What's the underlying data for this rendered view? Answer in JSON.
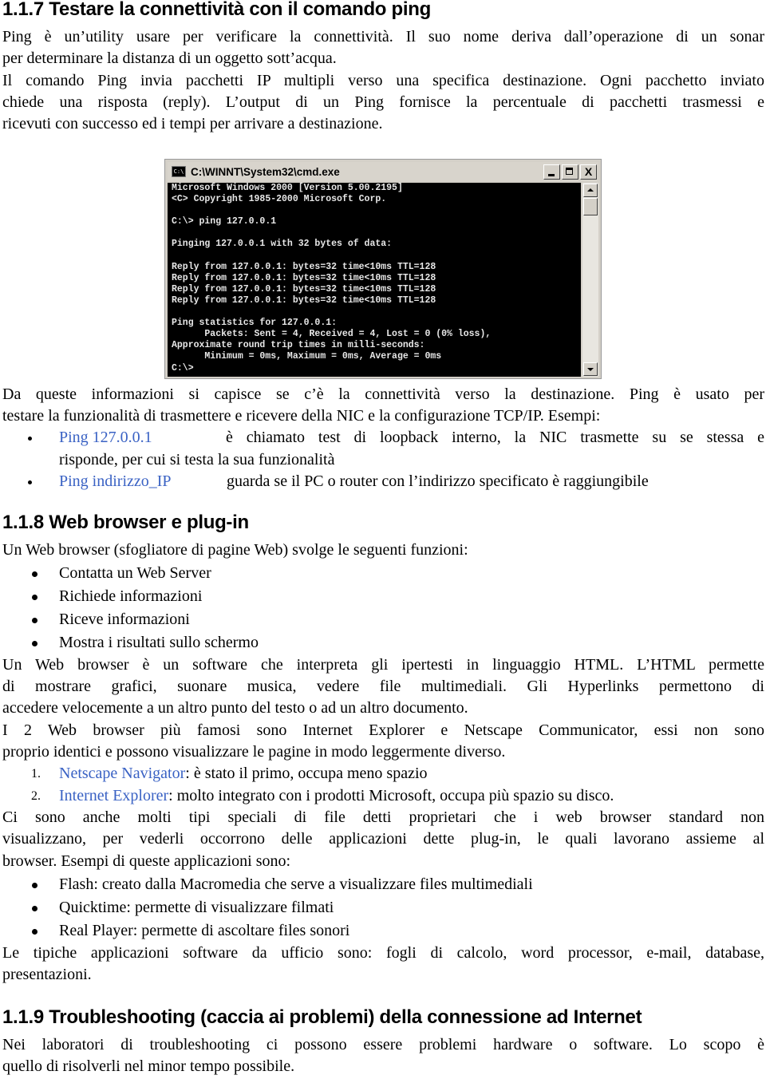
{
  "section_117": {
    "heading": "1.1.7 Testare la connettività con il comando ping",
    "para1_line1": "Ping è un’utility usare per verificare la connettività. Il suo nome deriva dall’operazione di un sonar",
    "para1_line2": "per determinare la distanza di un oggetto sott’acqua.",
    "para2_line1": "Il comando Ping invia pacchetti IP multipli verso una specifica destinazione. Ogni pacchetto inviato",
    "para2_line2": "chiede una risposta (reply). L’output di un Ping fornisce la percentuale di pacchetti trasmessi e",
    "para2_line3": "ricevuti con successo ed i tempi per arrivare a destinazione.",
    "cmd_window": {
      "title": "C:\\WINNT\\System32\\cmd.exe",
      "icon_label": "C:\\",
      "lines": [
        "Microsoft Windows 2000 [Version 5.00.2195]",
        "<C> Copyright 1985-2000 Microsoft Corp.",
        "",
        "C:\\> ping 127.0.0.1",
        "",
        "Pinging 127.0.0.1 with 32 bytes of data:",
        "",
        "Reply from 127.0.0.1: bytes=32 time<10ms TTL=128",
        "Reply from 127.0.0.1: bytes=32 time<10ms TTL=128",
        "Reply from 127.0.0.1: bytes=32 time<10ms TTL=128",
        "Reply from 127.0.0.1: bytes=32 time<10ms TTL=128",
        "",
        "Ping statistics for 127.0.0.1:",
        "      Packets: Sent = 4, Received = 4, Lost = 0 (0% loss),",
        "Approximate round trip times in milli-seconds:",
        "      Minimum = 0ms, Maximum = 0ms, Average = 0ms",
        "C:\\>"
      ],
      "close_glyph": "X"
    },
    "para3_line1": "Da queste informazioni si capisce se c’è la connettività verso la destinazione. Ping è usato per",
    "para3_line2": "testare la funzionalità di trasmettere e ricevere della NIC e la configurazione TCP/IP. Esempi:",
    "examples": [
      {
        "command": "Ping 127.0.0.1",
        "desc_line1": "è chiamato test di loopback interno, la NIC trasmette su se stessa e",
        "desc_line2": "risponde, per cui si testa la sua funzionalità"
      },
      {
        "command": "Ping indirizzo_IP",
        "desc_line1": "guarda se il PC o router con l’indirizzo specificato è raggiungibile"
      }
    ]
  },
  "section_118": {
    "heading": "1.1.8 Web browser e plug-in",
    "intro": "Un Web browser (sfogliatore di pagine Web) svolge le seguenti funzioni:",
    "functions": [
      "Contatta un Web Server",
      "Richiede informazioni",
      "Riceve informazioni",
      "Mostra i risultati sullo schermo"
    ],
    "para_html_line1": "Un Web browser è un software che interpreta gli ipertesti in linguaggio HTML. L’HTML permette",
    "para_html_line2": "di mostrare grafici, suonare musica, vedere file multimediali. Gli Hyperlinks permettono di",
    "para_html_line3": "accedere velocemente a un altro punto del testo o ad un altro documento.",
    "para_browsers_line1": "I 2 Web browser più famosi sono Internet Explorer e Netscape Communicator, essi non sono",
    "para_browsers_line2": "proprio identici e possono visualizzare le pagine in modo leggermente diverso.",
    "browsers": [
      {
        "num": "1.",
        "name": "Netscape Navigator",
        "desc": ": è stato il primo, occupa meno spazio"
      },
      {
        "num": "2.",
        "name": "Internet Explorer",
        "desc": ": molto integrato con i prodotti Microsoft, occupa più spazio su disco."
      }
    ],
    "para_plugin_line1": "Ci sono anche molti tipi speciali di file detti proprietari che i web browser standard non",
    "para_plugin_line2": "visualizzano, per vederli occorrono delle applicazioni dette plug-in, le quali lavorano assieme al",
    "para_plugin_line3": "browser. Esempi di queste applicazioni sono:",
    "plugins": [
      "Flash: creato dalla Macromedia che serve a visualizzare files multimediali",
      "Quicktime: permette di visualizzare filmati",
      "Real Player: permette di ascoltare files sonori"
    ],
    "para_office_line1": "Le tipiche applicazioni software da ufficio sono: fogli  di calcolo, word processor, e-mail, database,",
    "para_office_line2": "presentazioni."
  },
  "section_119": {
    "heading": "1.1.9 Troubleshooting (caccia ai problemi) della connessione ad Internet",
    "para_line1": "Nei laboratori di troubleshooting ci possono essere problemi hardware o software. Lo scopo è",
    "para_line2": "quello di risolverli nel minor tempo possibile."
  },
  "colors": {
    "link_blue": "#3a62c4",
    "console_bg": "#000000",
    "console_text": "#e8e8e8",
    "window_chrome": "#d4d0c8"
  }
}
